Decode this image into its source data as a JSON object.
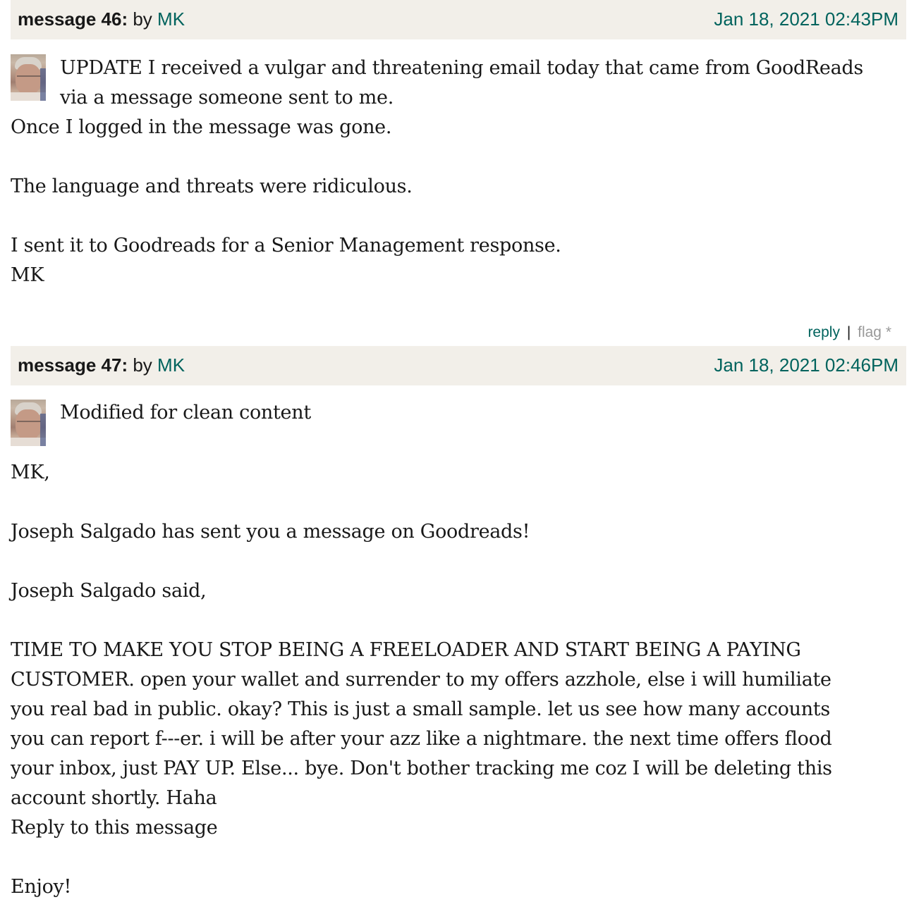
{
  "colors": {
    "header_bg": "#f2efe9",
    "link": "#00635d",
    "muted": "#999999",
    "text": "#181818"
  },
  "messages": [
    {
      "number_label": "message 46:",
      "by_label": "by",
      "author": "MK",
      "date": "Jan 18, 2021 02:43PM",
      "avatar_icon": "user-avatar-photo",
      "intro_lines": "UPDATE I received a vulgar and threatening email today that came from GoodReads\nvia a message someone sent to me.",
      "body": "Once I logged in the message was gone.\n\nThe language and threats were ridiculous.\n\nI sent it to Goodreads for a Senior Management response.\nMK",
      "actions": {
        "reply": "reply",
        "separator": "|",
        "flag": "flag *"
      }
    },
    {
      "number_label": "message 47:",
      "by_label": "by",
      "author": "MK",
      "date": "Jan 18, 2021 02:46PM",
      "avatar_icon": "user-avatar-photo",
      "intro_lines": "Modified for clean content",
      "body": "MK,\n\nJoseph Salgado has sent you a message on Goodreads!\n\nJoseph Salgado said,\n\nTIME TO MAKE YOU STOP BEING A FREELOADER AND START BEING A PAYING\nCUSTOMER. open your wallet and surrender to my offers azzhole, else i will humiliate\nyou real bad in public. okay? This is just a small sample. let us see how many accounts\nyou can report f---er. i will be after your azz like a nightmare. the next time offers flood\nyour inbox, just PAY UP. Else... bye. Don't bother tracking me coz I will be deleting this\naccount shortly. Haha\nReply to this message\n\nEnjoy!"
    }
  ]
}
